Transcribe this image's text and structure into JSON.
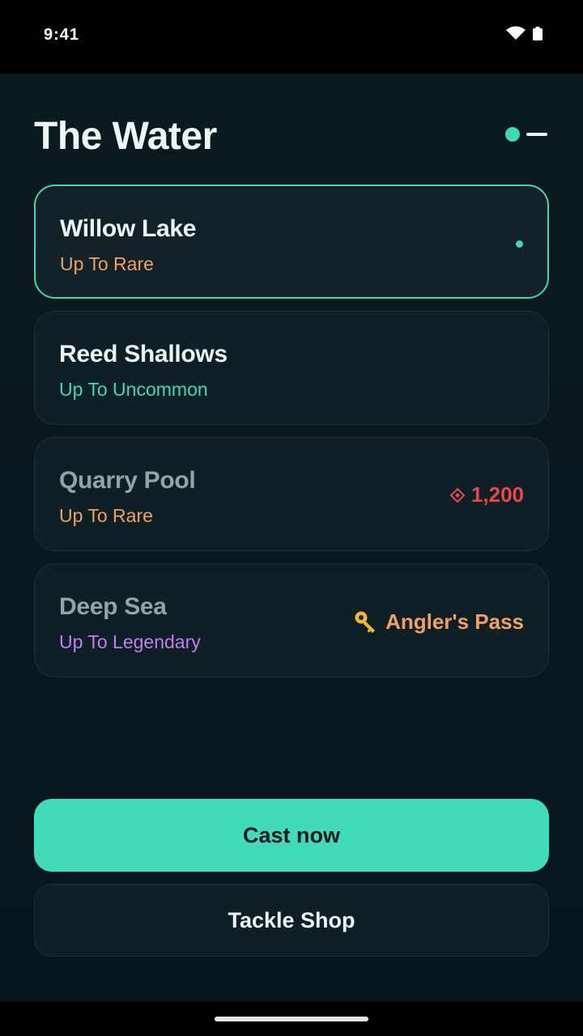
{
  "status_bar": {
    "time": "9:41"
  },
  "page": {
    "title": "The Water"
  },
  "locations": [
    {
      "name": "Willow Lake",
      "tier": "Up To Rare",
      "state": "selected"
    },
    {
      "name": "Reed Shallows",
      "tier": "Up To Uncommon",
      "state": "unlocked"
    },
    {
      "name": "Quarry Pool",
      "tier": "Up To Rare",
      "state": "locked",
      "price": "1,200"
    },
    {
      "name": "Deep Sea",
      "tier": "Up To Legendary",
      "state": "locked",
      "requirement": "Angler's Pass"
    }
  ],
  "actions": {
    "cast_label": "Cast now",
    "shop_label": "Tackle Shop"
  },
  "colors": {
    "accent": "#3fd9b5",
    "rare": "#f0a060",
    "uncommon": "#3fd9b5",
    "legendary": "#c17cf0",
    "price": "#e5484d",
    "background": "#0b1a1f"
  },
  "icons": {
    "price": "gem-icon",
    "pass": "key-icon",
    "signal": "wifi-icon",
    "power": "battery-icon"
  }
}
